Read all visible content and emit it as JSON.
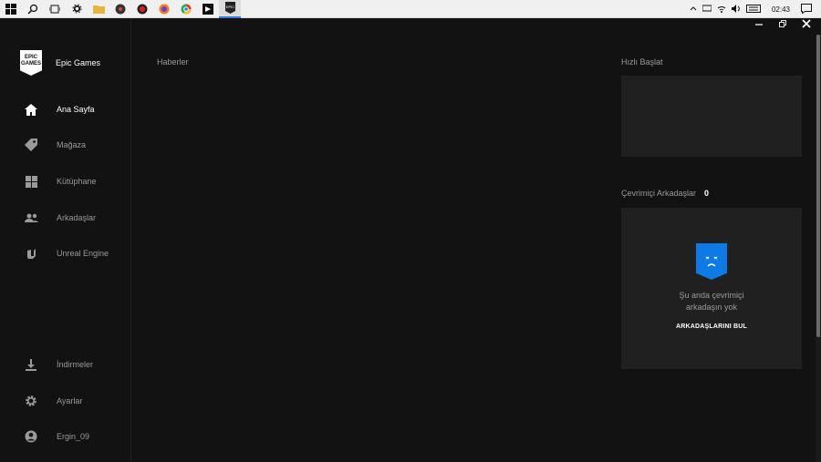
{
  "taskbar": {
    "apps": [
      {
        "icon": "windows-start-icon"
      },
      {
        "icon": "search-icon"
      },
      {
        "icon": "task-view-icon"
      },
      {
        "icon": "settings-icon"
      },
      {
        "icon": "file-explorer-icon"
      },
      {
        "icon": "media-player-icon"
      },
      {
        "icon": "record-icon"
      },
      {
        "icon": "firefox-icon"
      },
      {
        "icon": "chrome-icon"
      },
      {
        "icon": "unity-icon"
      },
      {
        "icon": "epic-games-icon"
      }
    ],
    "tray": {
      "clock": "02:43"
    }
  },
  "app": {
    "brand": "Epic Games",
    "logo_text": "EPIC GAMES",
    "nav_top": [
      {
        "label": "Ana Sayfa",
        "icon": "home-icon",
        "active": true
      },
      {
        "label": "Mağaza",
        "icon": "tag-icon"
      },
      {
        "label": "Kütüphane",
        "icon": "grid-icon"
      },
      {
        "label": "Arkadaşlar",
        "icon": "friends-icon"
      },
      {
        "label": "Unreal Engine",
        "icon": "unreal-icon"
      }
    ],
    "nav_bottom": [
      {
        "label": "İndirmeler",
        "icon": "download-icon"
      },
      {
        "label": "Ayarlar",
        "icon": "gear-icon"
      },
      {
        "label": "Ergin_09",
        "icon": "user-icon"
      }
    ],
    "main": {
      "news_title": "Haberler",
      "quick_launch_title": "Hızlı Başlat",
      "friends_title": "Çevrimiçi Arkadaşlar",
      "friends_count": "0",
      "friends_empty_line1": "Şu anda çevrimiçi",
      "friends_empty_line2": "arkadaşın yok",
      "find_friends": "ARKADAŞLARINI BUL"
    }
  },
  "colors": {
    "background": "#121212",
    "panel": "#202020",
    "accent": "#0e7ae6",
    "text_muted": "#9a9a9a"
  }
}
